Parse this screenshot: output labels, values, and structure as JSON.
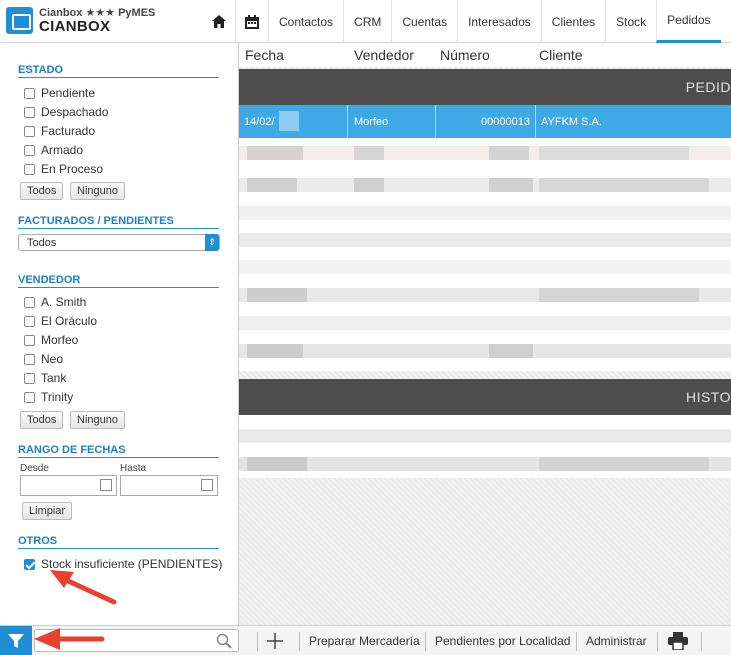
{
  "app": {
    "subtitle": "Cianbox ★★★ PyMES",
    "name": "CIANBOX"
  },
  "nav": {
    "items": [
      "Contactos",
      "CRM",
      "Cuentas",
      "Interesados",
      "Clientes",
      "Stock",
      "Pedidos"
    ],
    "active": "Pedidos"
  },
  "sidebar": {
    "estado": {
      "title": "ESTADO",
      "options": [
        "Pendiente",
        "Despachado",
        "Facturado",
        "Armado",
        "En Proceso"
      ],
      "btn_all": "Todos",
      "btn_none": "Ninguno"
    },
    "facturados": {
      "title": "FACTURADOS / PENDIENTES",
      "selected": "Todos"
    },
    "vendedor": {
      "title": "VENDEDOR",
      "options": [
        "A. Smith",
        "El Oráculo",
        "Morfeo",
        "Neo",
        "Tank",
        "Trinity"
      ],
      "btn_all": "Todos",
      "btn_none": "Ninguno"
    },
    "fechas": {
      "title": "RANGO DE FECHAS",
      "desde": "Desde",
      "hasta": "Hasta",
      "btn_clear": "Limpiar"
    },
    "otros": {
      "title": "OTROS",
      "option": "Stock insuficiente (PENDIENTES)",
      "checked": true
    }
  },
  "table": {
    "headers": [
      "Fecha",
      "Vendedor",
      "Número",
      "Cliente"
    ],
    "band1": "PEDID",
    "band2": "HISTO",
    "selected_row": {
      "fecha": "14/02/",
      "vendedor": "Morfeo",
      "numero": "00000013",
      "cliente": "AYFKM S.A."
    }
  },
  "bottombar": {
    "search_placeholder": "",
    "preparar": "Preparar Mercadería",
    "pendientes": "Pendientes por Localidad",
    "administrar": "Administrar"
  },
  "colors": {
    "accent": "#1e8fd6",
    "band": "#4d4d4d",
    "selected_row": "#3fa9e6",
    "annotation_arrow": "#e8412c"
  }
}
